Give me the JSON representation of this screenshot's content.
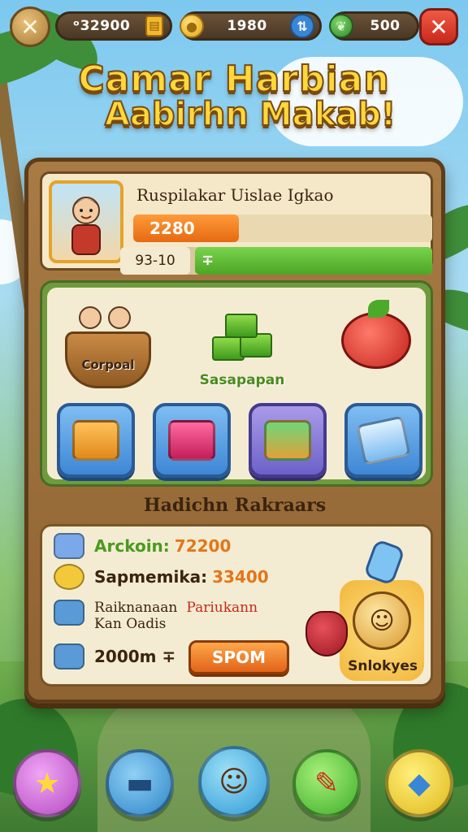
{
  "topbar": {
    "back_icon": "x-icon",
    "resources": [
      {
        "value": "ᵒ32900",
        "icon": "gold-box-icon"
      },
      {
        "value": "1980",
        "icon": "coin-icon"
      },
      {
        "value": "500",
        "icon": "leaf-icon"
      }
    ],
    "close_icon": "close-icon"
  },
  "title": {
    "line1": "Camar Harbian",
    "line2": "Aabirhn Makab!"
  },
  "profile": {
    "name": "Ruspilakar Uislae Igkao",
    "bar1_value": "2280",
    "bar2_label": "93-10",
    "bar2_value": "∓"
  },
  "shop": {
    "items": [
      {
        "label": "Corpoal"
      },
      {
        "label": "Sasapapan"
      },
      {
        "label": ""
      }
    ],
    "categories": [
      {
        "icon": "treasure-chest-icon"
      },
      {
        "icon": "gift-ticket-icon"
      },
      {
        "icon": "books-icon"
      },
      {
        "icon": "crystal-card-icon"
      }
    ]
  },
  "rewards": {
    "title": "Hadichn Rakraars",
    "rows": [
      {
        "label": "Arckoin:",
        "value": "72200"
      },
      {
        "label": "Sapmemika:",
        "value": "33400"
      },
      {
        "label": "Raiknanaan",
        "value": "Pariukann",
        "sub": "Kan Oadis"
      },
      {
        "label": "2000m ∓",
        "value": ""
      }
    ],
    "button_label": "SPOM",
    "mascot_label": "Snlokyes"
  },
  "bottom_nav": [
    {
      "icon": "star-coin-icon"
    },
    {
      "icon": "scroll-icon"
    },
    {
      "icon": "avatar-icon"
    },
    {
      "icon": "pencil-tool-icon"
    },
    {
      "icon": "gem-icon"
    }
  ],
  "colors": {
    "title_yellow": "#ffd83b",
    "panel_brown": "#a87b45",
    "accent_orange": "#e56a12",
    "accent_green": "#4ca624"
  }
}
